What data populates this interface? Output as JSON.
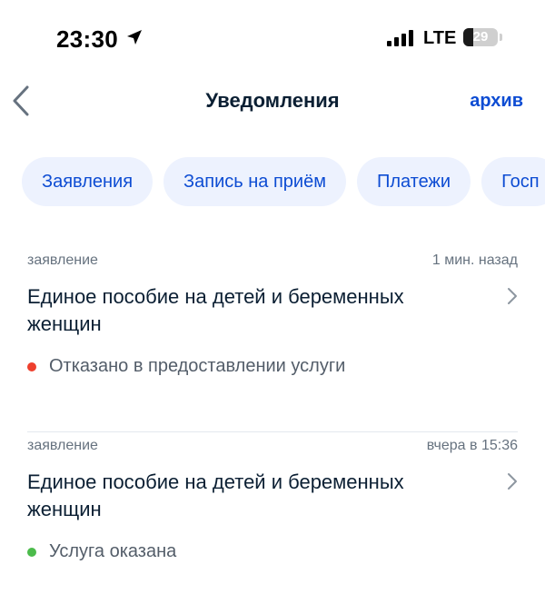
{
  "status_bar": {
    "time": "23:30",
    "network": "LTE",
    "battery_level": "29",
    "battery_fraction": 0.29
  },
  "nav": {
    "title": "Уведомления",
    "archive_label": "архив"
  },
  "chips": [
    {
      "label": "Заявления"
    },
    {
      "label": "Запись на приём"
    },
    {
      "label": "Платежи"
    },
    {
      "label": "Госп"
    }
  ],
  "notifications": [
    {
      "type": "заявление",
      "time": "1 мин. назад",
      "title": "Единое пособие на детей и беременных женщин",
      "status": "Отказано в предоставлении услуги",
      "status_color": "#ee3f2d"
    },
    {
      "type": "заявление",
      "time": "вчера в 15:36",
      "title": "Единое пособие на детей и беременных женщин",
      "status": "Услуга оказана",
      "status_color": "#4cbb4b"
    }
  ],
  "colors": {
    "accent": "#0d4cd3",
    "chip_bg": "#edf2fe",
    "text_primary": "#0b1f33",
    "text_secondary": "#66727f"
  }
}
